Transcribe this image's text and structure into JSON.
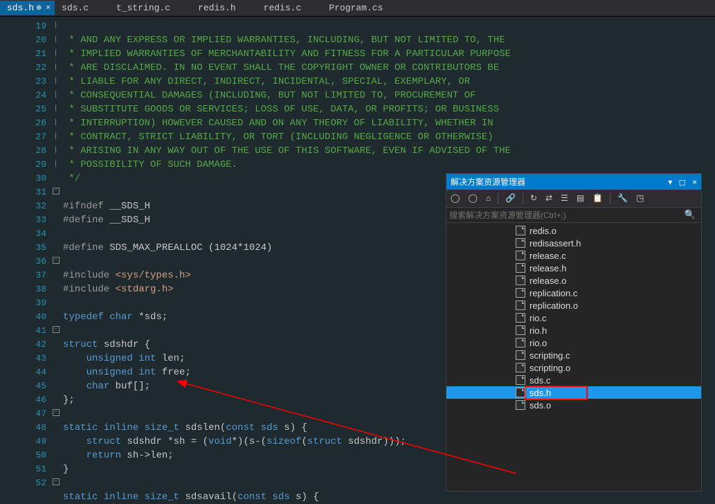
{
  "tabs": [
    {
      "label": "sds.h",
      "active": true
    },
    {
      "label": "sds.c"
    },
    {
      "label": "t_string.c"
    },
    {
      "label": "redis.h"
    },
    {
      "label": "redis.c"
    },
    {
      "label": "Program.cs"
    }
  ],
  "lines": {
    "start": 19,
    "count": 34
  },
  "code": {
    "l19": " * AND ANY EXPRESS OR IMPLIED WARRANTIES, INCLUDING, BUT NOT LIMITED TO, THE",
    "l20": " * IMPLIED WARRANTIES OF MERCHANTABILITY AND FITNESS FOR A PARTICULAR PURPOSE",
    "l21": " * ARE DISCLAIMED. IN NO EVENT SHALL THE COPYRIGHT OWNER OR CONTRIBUTORS BE",
    "l22": " * LIABLE FOR ANY DIRECT, INDIRECT, INCIDENTAL, SPECIAL, EXEMPLARY, OR",
    "l23": " * CONSEQUENTIAL DAMAGES (INCLUDING, BUT NOT LIMITED TO, PROCUREMENT OF",
    "l24": " * SUBSTITUTE GOODS OR SERVICES; LOSS OF USE, DATA, OR PROFITS; OR BUSINESS",
    "l25": " * INTERRUPTION) HOWEVER CAUSED AND ON ANY THEORY OF LIABILITY, WHETHER IN",
    "l26": " * CONTRACT, STRICT LIABILITY, OR TORT (INCLUDING NEGLIGENCE OR OTHERWISE)",
    "l27": " * ARISING IN ANY WAY OUT OF THE USE OF THIS SOFTWARE, EVEN IF ADVISED OF THE",
    "l28": " * POSSIBILITY OF SUCH DAMAGE.",
    "l29": " */",
    "ifndef": "#ifndef",
    "defn": "__SDS_H",
    "define": "#define",
    "define2": "#define",
    "macro": "SDS_MAX_PREALLOC",
    "macroExpr": "(1024*1024)",
    "include": "#include",
    "inc1": "<sys/types.h>",
    "inc2": "<stdarg.h>",
    "typedef": "typedef",
    "char": "char",
    "sds": "*sds",
    "semicolon": ";",
    "struct": "struct",
    "sdshdr": "sdshdr",
    "lbrace": " {",
    "unsigned": "unsigned",
    "int": "int",
    "len": " len",
    "free": " free",
    "buf": " buf[]",
    "rbrace": "};",
    "static": "static",
    "inline": "inline",
    "size_t": "size_t",
    "sdslen": "sdslen",
    "params": "(",
    "const": "const",
    "sdsP": " sds ",
    "sArg": "s",
    "closep": ") {",
    "structLine": "    struct",
    "shDecl": " sdshdr *sh = (",
    "void": "void",
    "rest": "*)(s-(",
    "sizeof": "sizeof",
    "rest2": "(",
    "rest3": " sdshdr)));",
    "return": "return",
    "retExpr": " sh->len;",
    "sdsavail": "sdsavail"
  },
  "panel": {
    "title": "解决方案资源管理器",
    "search_placeholder": "搜索解决方案资源管理器(Ctrl+;)",
    "files": [
      "redis.o",
      "redisassert.h",
      "release.c",
      "release.h",
      "release.o",
      "replication.c",
      "replication.o",
      "rio.c",
      "rio.h",
      "rio.o",
      "scripting.c",
      "scripting.o",
      "sds.c",
      "sds.h",
      "sds.o"
    ],
    "selected": "sds.h"
  }
}
